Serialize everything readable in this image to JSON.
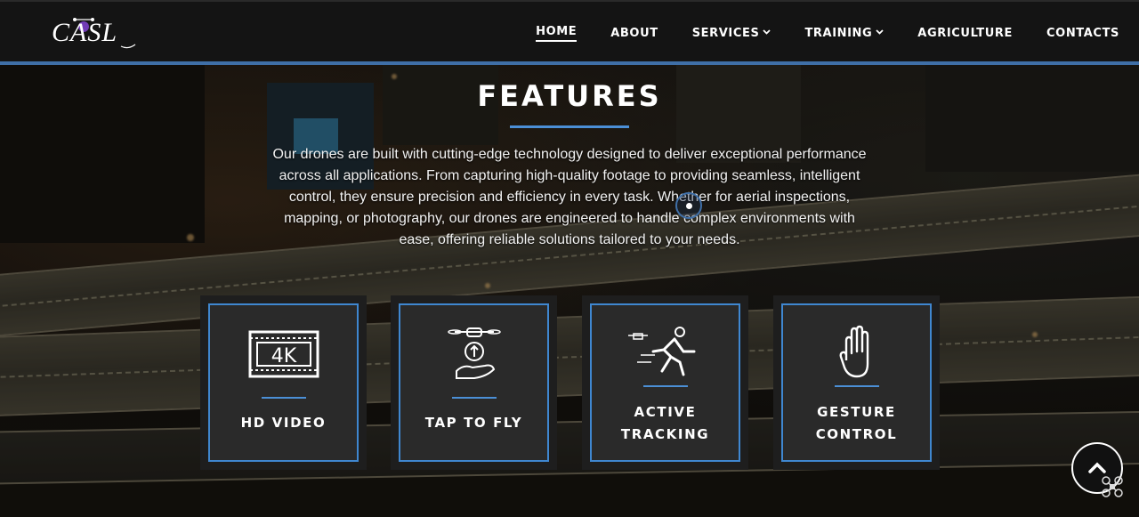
{
  "header": {
    "logo_text": "CASL",
    "nav": [
      {
        "label": "HOME",
        "active": true,
        "dropdown": false
      },
      {
        "label": "ABOUT",
        "active": false,
        "dropdown": false
      },
      {
        "label": "SERVICES",
        "active": false,
        "dropdown": true
      },
      {
        "label": "TRAINING",
        "active": false,
        "dropdown": true
      },
      {
        "label": "AGRICULTURE",
        "active": false,
        "dropdown": false
      },
      {
        "label": "CONTACTS",
        "active": false,
        "dropdown": false
      }
    ],
    "dropdown_glyph": "⌄"
  },
  "features": {
    "title": "FEATURES",
    "description": "Our drones are built with cutting-edge technology designed to deliver exceptional performance across all applications. From capturing high-quality footage to providing seamless, intelligent control, they ensure precision and efficiency in every task. Whether for aerial inspections, mapping, or photography, our drones are engineered to handle complex environments with ease, offering reliable solutions tailored to your needs.",
    "cards": [
      {
        "icon": "4k-video-icon",
        "icon_text": "4K",
        "label_lines": [
          "HD VIDEO"
        ]
      },
      {
        "icon": "tap-to-fly-icon",
        "label_lines": [
          "TAP TO FLY"
        ]
      },
      {
        "icon": "active-tracking-icon",
        "label_lines": [
          "ACTIVE",
          "TRACKING"
        ]
      },
      {
        "icon": "gesture-hand-icon",
        "label_lines": [
          "GESTURE",
          "CONTROL"
        ]
      }
    ]
  },
  "floating": {
    "scroll_top_glyph": "⌃",
    "scroll_top_icon": "chevron-up-icon",
    "drone_icon": "drone-icon"
  },
  "colors": {
    "accent_blue": "#3f87d0",
    "header_line": "#3f6fa7",
    "header_bg": "#141414",
    "card_bg": "#2a2a2a"
  }
}
